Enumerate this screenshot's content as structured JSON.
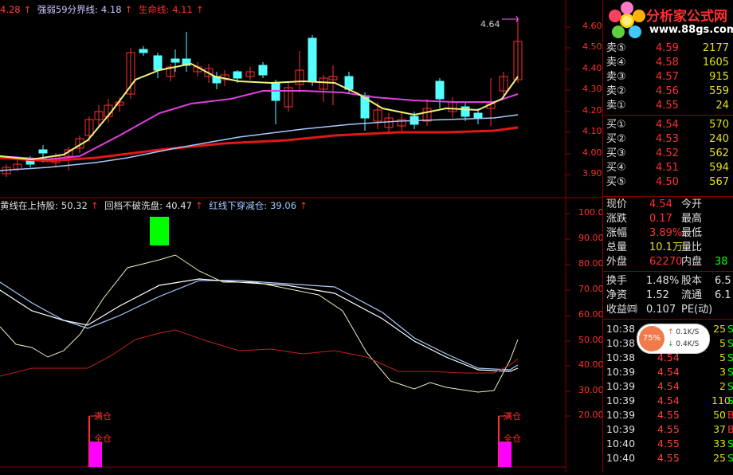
{
  "top_indicators": {
    "first_value": "4.28",
    "line2_label": "强弱59分界线:",
    "line2_value": "4.18",
    "line3_label": "生命线:",
    "line3_value": "4.11",
    "arrow": "↑"
  },
  "price_axis": [
    "4.60",
    "4.50",
    "4.40",
    "4.30",
    "4.20",
    "4.10",
    "4.00",
    "3.90"
  ],
  "peak_label": "4.64",
  "bottom_indicators": {
    "a_label": "黄线在上持股:",
    "a_value": "50.32",
    "b_label": "回档不破洗盘:",
    "b_value": "40.47",
    "c_label": "红线下穿减仓:",
    "c_value": "39.06",
    "arrow": "↑"
  },
  "osc_axis": [
    "100.0",
    "90.00",
    "80.00",
    "70.00",
    "60.00",
    "50.00",
    "40.00",
    "30.00",
    "20.00"
  ],
  "signals": [
    {
      "top": "满仓",
      "bottom": "全仓"
    },
    {
      "top": "满仓",
      "bottom": "全仓"
    }
  ],
  "logo": {
    "title": "分析家公式网",
    "url": "www.88gs.com"
  },
  "order_book": {
    "sells": [
      {
        "label": "卖⑤",
        "price": "4.59",
        "vol": "2177"
      },
      {
        "label": "卖④",
        "price": "4.58",
        "vol": "1605"
      },
      {
        "label": "卖③",
        "price": "4.57",
        "vol": "915"
      },
      {
        "label": "卖②",
        "price": "4.56",
        "vol": "559"
      },
      {
        "label": "卖①",
        "price": "4.55",
        "vol": "24"
      }
    ],
    "buys": [
      {
        "label": "买①",
        "price": "4.54",
        "vol": "570"
      },
      {
        "label": "买②",
        "price": "4.53",
        "vol": "240"
      },
      {
        "label": "买③",
        "price": "4.52",
        "vol": "562"
      },
      {
        "label": "买④",
        "price": "4.51",
        "vol": "594"
      },
      {
        "label": "买⑤",
        "price": "4.50",
        "vol": "567"
      }
    ]
  },
  "quote": [
    {
      "a": "现价",
      "b": "4.54",
      "c": "今开",
      "d": ""
    },
    {
      "a": "涨跌",
      "b": "0.17",
      "c": "最高",
      "d": ""
    },
    {
      "a": "涨幅",
      "b": "3.89%",
      "c": "最低",
      "d": ""
    },
    {
      "a": "总量",
      "b": "10.1万",
      "c": "量比",
      "d": ""
    },
    {
      "a": "外盘",
      "b": "62270",
      "c": "内盘",
      "d": "38"
    }
  ],
  "quote2": [
    {
      "a": "换手",
      "b": "1.48%",
      "c": "股本",
      "d": "6.5"
    },
    {
      "a": "净资",
      "b": "1.52",
      "c": "流通",
      "d": "6.1"
    },
    {
      "a": "收益㈣",
      "b": "0.107",
      "c": "PE(动)",
      "d": ""
    }
  ],
  "speed_widget": {
    "percent": "75%",
    "up": "0.1K/S",
    "down": "0.4K/S"
  },
  "ticks": [
    {
      "time": "10:38",
      "price": "4.55",
      "vol": "25",
      "f": "S"
    },
    {
      "time": "10:38",
      "price": "4.55",
      "vol": "5",
      "f": "S"
    },
    {
      "time": "10:38",
      "price": "4.54",
      "vol": "5",
      "f": "S"
    },
    {
      "time": "10:39",
      "price": "4.54",
      "vol": "3",
      "f": "S"
    },
    {
      "time": "10:39",
      "price": "4.54",
      "vol": "2",
      "f": "S"
    },
    {
      "time": "10:39",
      "price": "4.54",
      "vol": "110",
      "f": "S"
    },
    {
      "time": "10:39",
      "price": "4.55",
      "vol": "50",
      "f": "B"
    },
    {
      "time": "10:39",
      "price": "4.55",
      "vol": "37",
      "f": "B"
    },
    {
      "time": "10:40",
      "price": "4.55",
      "vol": "33",
      "f": "S"
    },
    {
      "time": "10:40",
      "price": "4.55",
      "vol": "25",
      "f": "S"
    }
  ],
  "colors": {
    "up": "#ff3030",
    "down": "#54ffff",
    "frame": "#8b0000",
    "yellow": "#e0e020",
    "green": "#00ff00",
    "magenta": "#ff00ff"
  }
}
